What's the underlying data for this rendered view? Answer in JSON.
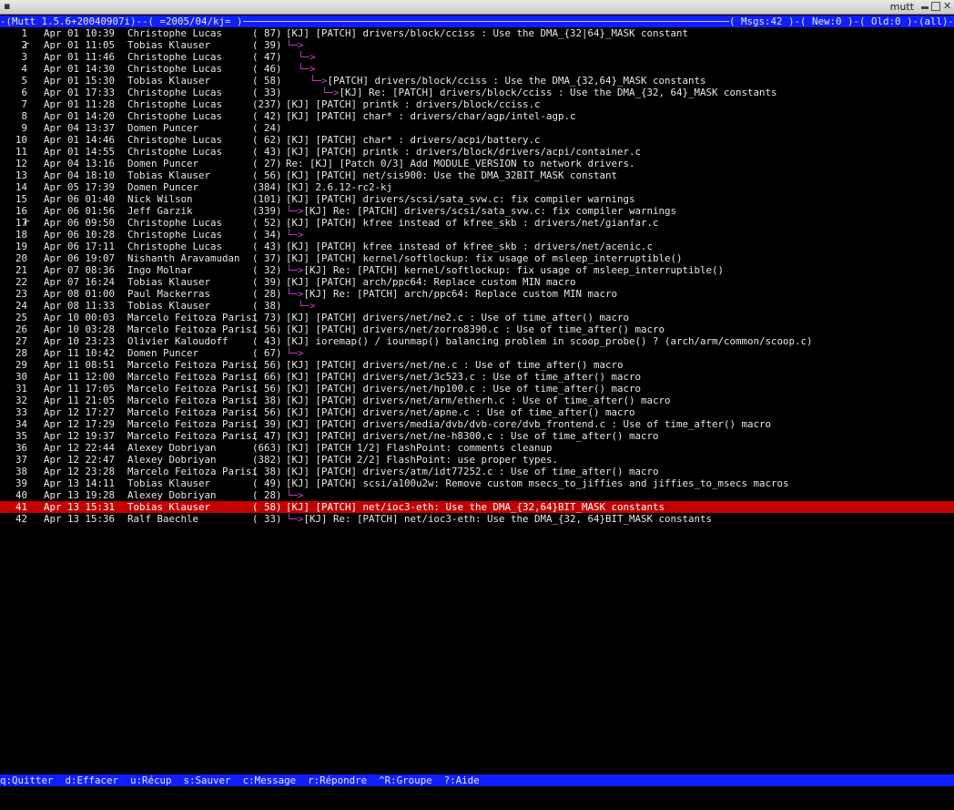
{
  "window": {
    "title": "mutt"
  },
  "status": {
    "left": "-(Mutt 1.5.6+20040907i)--( =2005/04/kj= )",
    "right": "( Msgs:42 )-( New:0 )-( Old:0 )-(all)-"
  },
  "messages": [
    {
      "num": "1",
      "flag": "",
      "date": "Apr 01 10:39",
      "author": "Christophe Lucas",
      "size": "( 87)",
      "tree": "",
      "subject": "[KJ] [PATCH] drivers/block/cciss : Use the DMA_{32|64}_MASK constant"
    },
    {
      "num": "2",
      "flag": "r",
      "date": "Apr 01 11:05",
      "author": "Tobias Klauser",
      "size": "( 39)",
      "tree": "└─>",
      "subject": ""
    },
    {
      "num": "3",
      "flag": "",
      "date": "Apr 01 11:46",
      "author": "Christophe Lucas",
      "size": "( 47)",
      "tree": "  └─>",
      "subject": ""
    },
    {
      "num": "4",
      "flag": "",
      "date": "Apr 01 14:30",
      "author": "Christophe Lucas",
      "size": "( 46)",
      "tree": "  └─>",
      "subject": ""
    },
    {
      "num": "5",
      "flag": "",
      "date": "Apr 01 15:30",
      "author": "Tobias Klauser",
      "size": "( 58)",
      "tree": "    └─>",
      "subject": "[PATCH] drivers/block/cciss : Use the DMA_{32,64}_MASK constants"
    },
    {
      "num": "6",
      "flag": "",
      "date": "Apr 01 17:33",
      "author": "Christophe Lucas",
      "size": "( 33)",
      "tree": "      └─>",
      "subject": "[KJ] Re: [PATCH] drivers/block/cciss : Use the DMA_{32, 64}_MASK constants"
    },
    {
      "num": "7",
      "flag": "",
      "date": "Apr 01 11:28",
      "author": "Christophe Lucas",
      "size": "(237)",
      "tree": "",
      "subject": "[KJ] [PATCH] printk : drivers/block/cciss.c"
    },
    {
      "num": "8",
      "flag": "",
      "date": "Apr 01 14:20",
      "author": "Christophe Lucas",
      "size": "( 42)",
      "tree": "",
      "subject": "[KJ] [PATCH] char* : drivers/char/agp/intel-agp.c"
    },
    {
      "num": "9",
      "flag": "",
      "date": "Apr 04 13:37",
      "author": "Domen Puncer",
      "size": "( 24)",
      "tree": "",
      "subject": ""
    },
    {
      "num": "10",
      "flag": "",
      "date": "Apr 01 14:46",
      "author": "Christophe Lucas",
      "size": "( 62)",
      "tree": "",
      "subject": "[KJ] [PATCH] char* : drivers/acpi/battery.c"
    },
    {
      "num": "11",
      "flag": "",
      "date": "Apr 01 14:55",
      "author": "Christophe Lucas",
      "size": "( 43)",
      "tree": "",
      "subject": "[KJ] [PATCH] printk : drivers/block/drivers/acpi/container.c"
    },
    {
      "num": "12",
      "flag": "",
      "date": "Apr 04 13:16",
      "author": "Domen Puncer",
      "size": "( 27)",
      "tree": "",
      "subject": "Re: [KJ] [Patch 0/3] Add MODULE_VERSION to network drivers."
    },
    {
      "num": "13",
      "flag": "",
      "date": "Apr 04 18:10",
      "author": "Tobias Klauser",
      "size": "( 56)",
      "tree": "",
      "subject": "[KJ] [PATCH] net/sis900: Use the DMA_32BIT_MASK constant"
    },
    {
      "num": "14",
      "flag": "",
      "date": "Apr 05 17:39",
      "author": "Domen Puncer",
      "size": "(384)",
      "tree": "",
      "subject": "[KJ] 2.6.12-rc2-kj"
    },
    {
      "num": "15",
      "flag": "",
      "date": "Apr 06 01:40",
      "author": "Nick Wilson",
      "size": "(101)",
      "tree": "",
      "subject": "[KJ] [PATCH] drivers/scsi/sata_svw.c: fix compiler warnings"
    },
    {
      "num": "16",
      "flag": "",
      "date": "Apr 06 01:56",
      "author": "Jeff Garzik",
      "size": "(339)",
      "tree": "└─>",
      "subject": "[KJ] Re: [PATCH] drivers/scsi/sata_svw.c: fix compiler warnings"
    },
    {
      "num": "17",
      "flag": "r",
      "date": "Apr 06 09:50",
      "author": "Christophe Lucas",
      "size": "( 52)",
      "tree": "",
      "subject": "[KJ] [PATCH] kfree instead of kfree_skb : drivers/net/gianfar.c"
    },
    {
      "num": "18",
      "flag": "",
      "date": "Apr 06 10:28",
      "author": "Christophe Lucas",
      "size": "( 34)",
      "tree": "└─>",
      "subject": ""
    },
    {
      "num": "19",
      "flag": "",
      "date": "Apr 06 17:11",
      "author": "Christophe Lucas",
      "size": "( 43)",
      "tree": "",
      "subject": "[KJ] [PATCH] kfree instead of kfree_skb : drivers/net/acenic.c"
    },
    {
      "num": "20",
      "flag": "",
      "date": "Apr 06 19:07",
      "author": "Nishanth Aravamudan",
      "size": "( 37)",
      "tree": "",
      "subject": "[KJ] [PATCH] kernel/softlockup: fix usage of msleep_interruptible()"
    },
    {
      "num": "21",
      "flag": "",
      "date": "Apr 07 08:36",
      "author": "Ingo Molnar",
      "size": "( 32)",
      "tree": "└─>",
      "subject": "[KJ] Re: [PATCH] kernel/softlockup: fix usage of msleep_interruptible()"
    },
    {
      "num": "22",
      "flag": "",
      "date": "Apr 07 16:24",
      "author": "Tobias Klauser",
      "size": "( 39)",
      "tree": "",
      "subject": "[KJ] [PATCH] arch/ppc64: Replace custom MIN macro"
    },
    {
      "num": "23",
      "flag": "",
      "date": "Apr 08 01:00",
      "author": "Paul Mackerras",
      "size": "( 28)",
      "tree": "└─>",
      "subject": "[KJ] Re: [PATCH] arch/ppc64: Replace custom MIN macro"
    },
    {
      "num": "24",
      "flag": "",
      "date": "Apr 08 11:33",
      "author": "Tobias Klauser",
      "size": "( 38)",
      "tree": "  └─>",
      "subject": ""
    },
    {
      "num": "25",
      "flag": "",
      "date": "Apr 10 00:03",
      "author": "Marcelo Feitoza Parisi",
      "size": "( 73)",
      "tree": "",
      "subject": "[KJ] [PATCH] drivers/net/ne2.c : Use of time_after() macro"
    },
    {
      "num": "26",
      "flag": "",
      "date": "Apr 10 03:28",
      "author": "Marcelo Feitoza Parisi",
      "size": "( 56)",
      "tree": "",
      "subject": "[KJ] [PATCH] drivers/net/zorro8390.c : Use of time_after() macro"
    },
    {
      "num": "27",
      "flag": "",
      "date": "Apr 10 23:23",
      "author": "Olivier Kaloudoff",
      "size": "( 43)",
      "tree": "",
      "subject": "[KJ] ioremap() / iounmap() balancing problem in scoop_probe() ? (arch/arm/common/scoop.c)"
    },
    {
      "num": "28",
      "flag": "",
      "date": "Apr 11 10:42",
      "author": "Domen Puncer",
      "size": "( 67)",
      "tree": "└─>",
      "subject": ""
    },
    {
      "num": "29",
      "flag": "",
      "date": "Apr 11 08:51",
      "author": "Marcelo Feitoza Parisi",
      "size": "( 56)",
      "tree": "",
      "subject": "[KJ] [PATCH] drivers/net/ne.c : Use of time_after() macro"
    },
    {
      "num": "30",
      "flag": "",
      "date": "Apr 11 12:00",
      "author": "Marcelo Feitoza Parisi",
      "size": "( 66)",
      "tree": "",
      "subject": "[KJ] [PATCH] drivers/net/3c523.c : Use of time_after() macro"
    },
    {
      "num": "31",
      "flag": "",
      "date": "Apr 11 17:05",
      "author": "Marcelo Feitoza Parisi",
      "size": "( 56)",
      "tree": "",
      "subject": "[KJ] [PATCH] drivers/net/hp100.c : Use of time_after() macro"
    },
    {
      "num": "32",
      "flag": "",
      "date": "Apr 11 21:05",
      "author": "Marcelo Feitoza Parisi",
      "size": "( 38)",
      "tree": "",
      "subject": "[KJ] [PATCH] drivers/net/arm/etherh.c : Use of time_after() macro"
    },
    {
      "num": "33",
      "flag": "",
      "date": "Apr 12 17:27",
      "author": "Marcelo Feitoza Parisi",
      "size": "( 56)",
      "tree": "",
      "subject": "[KJ] [PATCH] drivers/net/apne.c : Use of time_after() macro"
    },
    {
      "num": "34",
      "flag": "",
      "date": "Apr 12 17:29",
      "author": "Marcelo Feitoza Parisi",
      "size": "( 39)",
      "tree": "",
      "subject": "[KJ] [PATCH] drivers/media/dvb/dvb-core/dvb_frontend.c : Use of time_after() macro"
    },
    {
      "num": "35",
      "flag": "",
      "date": "Apr 12 19:37",
      "author": "Marcelo Feitoza Parisi",
      "size": "( 47)",
      "tree": "",
      "subject": "[KJ] [PATCH] drivers/net/ne-h8300.c : Use of time_after() macro"
    },
    {
      "num": "36",
      "flag": "",
      "date": "Apr 12 22:44",
      "author": "Alexey Dobriyan",
      "size": "(663)",
      "tree": "",
      "subject": "[KJ] [PATCH 1/2] FlashPoint: comments cleanup"
    },
    {
      "num": "37",
      "flag": "",
      "date": "Apr 12 22:47",
      "author": "Alexey Dobriyan",
      "size": "(382)",
      "tree": "",
      "subject": "[KJ] [PATCH 2/2] FlashPoint: use proper types."
    },
    {
      "num": "38",
      "flag": "",
      "date": "Apr 12 23:28",
      "author": "Marcelo Feitoza Parisi",
      "size": "( 38)",
      "tree": "",
      "subject": "[KJ] [PATCH] drivers/atm/idt77252.c : Use of time_after() macro"
    },
    {
      "num": "39",
      "flag": "",
      "date": "Apr 13 14:11",
      "author": "Tobias Klauser",
      "size": "( 49)",
      "tree": "",
      "subject": "[KJ] [PATCH] scsi/a100u2w: Remove custom msecs_to_jiffies and jiffies_to_msecs macros"
    },
    {
      "num": "40",
      "flag": "",
      "date": "Apr 13 19:28",
      "author": "Alexey Dobriyan",
      "size": "( 28)",
      "tree": "└─>",
      "subject": ""
    },
    {
      "num": "41",
      "flag": "",
      "date": "Apr 13 15:31",
      "author": "Tobias Klauser",
      "size": "( 58)",
      "tree": "",
      "subject": "[KJ] [PATCH] net/ioc3-eth: Use the DMA_{32,64}BIT_MASK constants",
      "selected": true
    },
    {
      "num": "42",
      "flag": "",
      "date": "Apr 13 15:36",
      "author": "Ralf Baechle",
      "size": "( 33)",
      "tree": "└─>",
      "subject": "[KJ] Re: [PATCH] net/ioc3-eth: Use the DMA_{32, 64}BIT_MASK constants"
    }
  ],
  "help": [
    "q:Quitter",
    "d:Effacer",
    "u:Récup",
    "s:Sauver",
    "c:Message",
    "r:Répondre",
    "^R:Groupe",
    "?:Aide"
  ],
  "colors": {
    "status_bg": "#0f1fff",
    "selected_bg": "#c40000",
    "tree": "#cc44cc",
    "text": "#e6e6e6"
  }
}
